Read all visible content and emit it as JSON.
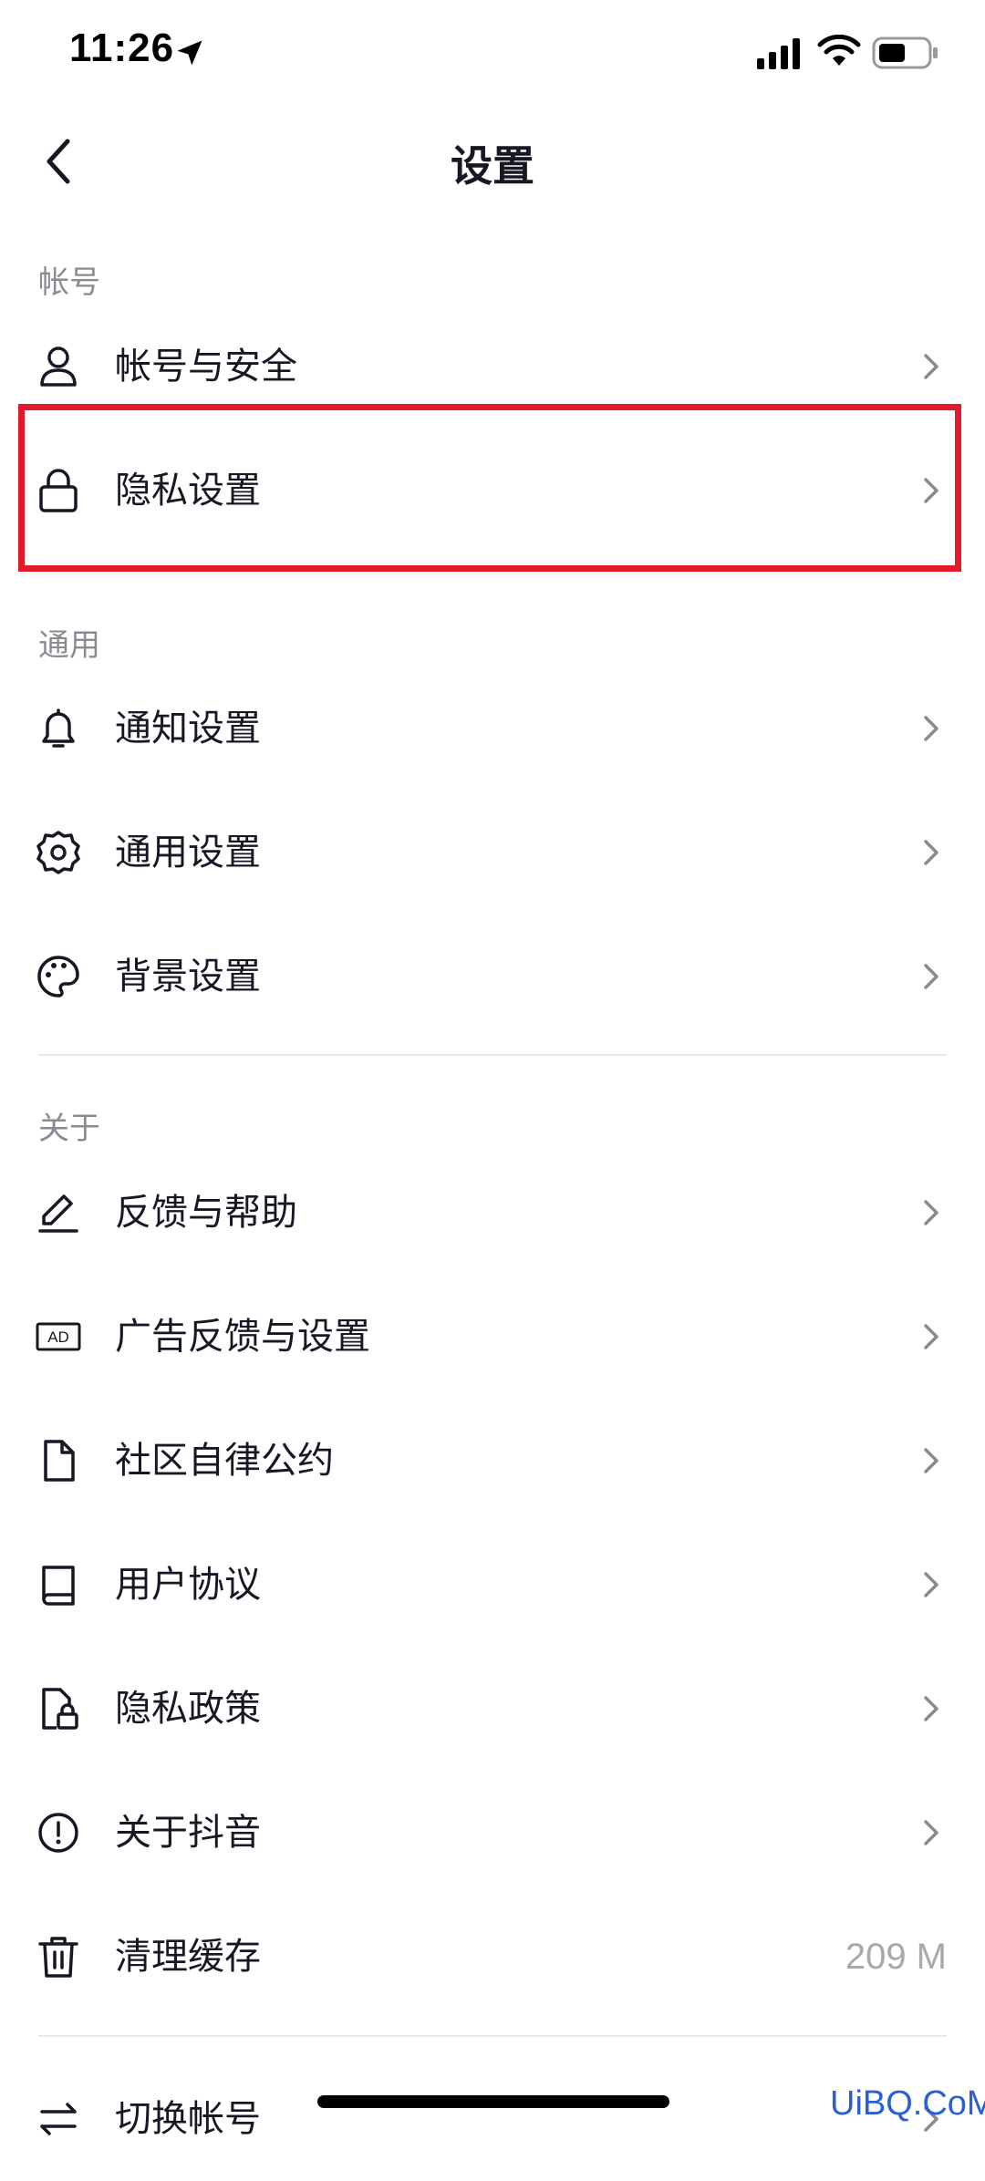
{
  "status_bar": {
    "time": "11:26"
  },
  "nav": {
    "title": "设置"
  },
  "sections": {
    "account": {
      "label": "帐号"
    },
    "general": {
      "label": "通用"
    },
    "about": {
      "label": "关于"
    }
  },
  "rows": {
    "account_security": "帐号与安全",
    "privacy_settings": "隐私设置",
    "notification_settings": "通知设置",
    "general_settings": "通用设置",
    "background_settings": "背景设置",
    "feedback_help": "反馈与帮助",
    "ad_feedback_settings": "广告反馈与设置",
    "community_guidelines": "社区自律公约",
    "user_agreement": "用户协议",
    "privacy_policy": "隐私政策",
    "about_douyin": "关于抖音",
    "clear_cache": "清理缓存",
    "clear_cache_value": "209 M",
    "switch_account": "切换帐号"
  },
  "icons": {
    "ad_badge_text": "AD"
  },
  "watermark": "UiBQ.CoM",
  "colors": {
    "highlight": "#e3192c",
    "text": "#161823",
    "secondary": "#8a8b91"
  }
}
